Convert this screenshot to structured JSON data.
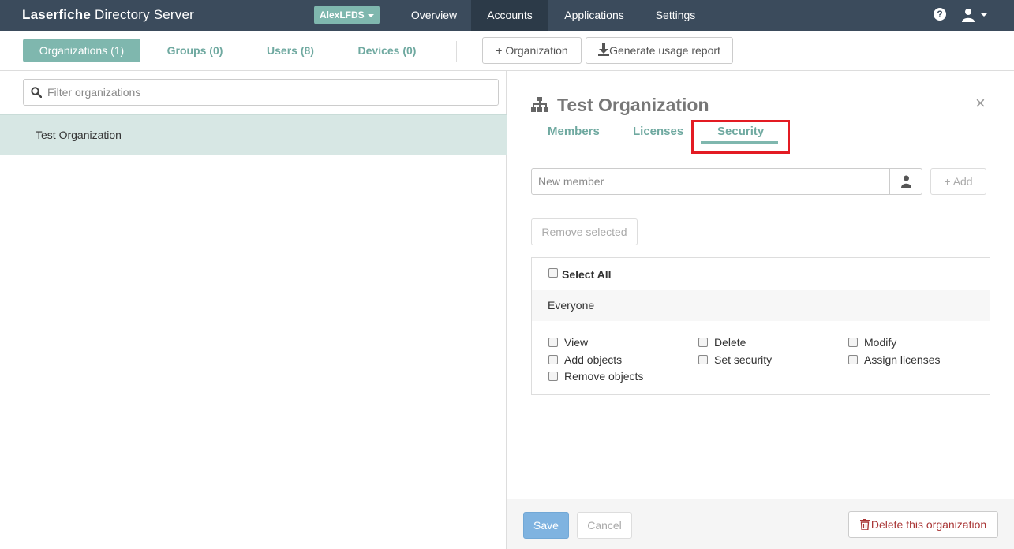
{
  "app": {
    "brand_bold": "Laserfiche",
    "brand_light": " Directory Server",
    "repo": "AlexLFDS"
  },
  "nav": {
    "items": [
      {
        "label": "Overview"
      },
      {
        "label": "Accounts",
        "active": true
      },
      {
        "label": "Applications"
      },
      {
        "label": "Settings"
      }
    ],
    "help_glyph": "?"
  },
  "subnav": {
    "tabs": [
      {
        "label": "Organizations (1)",
        "active": true
      },
      {
        "label": "Groups (0)"
      },
      {
        "label": "Users (8)"
      },
      {
        "label": "Devices (0)"
      }
    ],
    "add_org_label": "Organization",
    "report_label": "Generate usage report"
  },
  "left": {
    "filter_placeholder": "Filter organizations",
    "orgs": [
      "Test Organization"
    ]
  },
  "detail": {
    "title": "Test Organization",
    "close_glyph": "×",
    "tabs": [
      {
        "label": "Members"
      },
      {
        "label": "Licenses"
      },
      {
        "label": "Security",
        "active": true
      }
    ],
    "member_placeholder": "New member",
    "add_label": "Add",
    "remove_label": "Remove selected",
    "select_all_label": "Select All",
    "entry_name": "Everyone",
    "permissions": [
      "View",
      "Delete",
      "Modify",
      "Add objects",
      "Set security",
      "Assign licenses",
      "Remove objects"
    ]
  },
  "footer": {
    "save_label": "Save",
    "cancel_label": "Cancel",
    "delete_label": "Delete this organization"
  },
  "colors": {
    "navbar": "#3b4b5c",
    "accent": "#7fb7ae",
    "highlight": "#e31b23",
    "danger": "#a93535"
  }
}
